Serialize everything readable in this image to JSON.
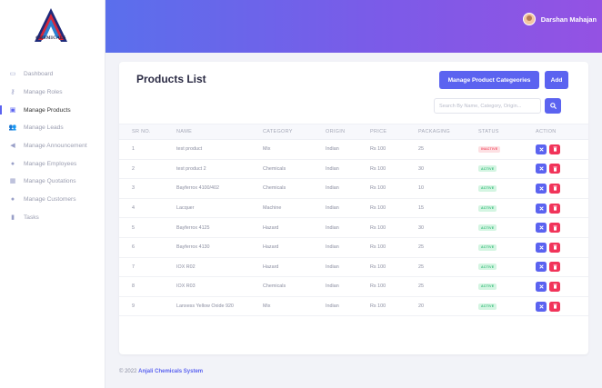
{
  "brand": {
    "logo_text": "CHEMICALS"
  },
  "header": {
    "user_name": "Darshan Mahajan"
  },
  "sidebar": {
    "items": [
      {
        "label": "Dashboard",
        "icon": "monitor-icon",
        "active": false
      },
      {
        "label": "Manage Roles",
        "icon": "key-icon",
        "active": false
      },
      {
        "label": "Manage Products",
        "icon": "box-icon",
        "active": true
      },
      {
        "label": "Manage Leads",
        "icon": "users-icon",
        "active": false
      },
      {
        "label": "Manage Announcement",
        "icon": "megaphone-icon",
        "active": false
      },
      {
        "label": "Manage Employees",
        "icon": "user-icon",
        "active": false
      },
      {
        "label": "Manage Quotations",
        "icon": "calendar-icon",
        "active": false
      },
      {
        "label": "Manage Customers",
        "icon": "user-icon",
        "active": false
      },
      {
        "label": "Tasks",
        "icon": "clipboard-icon",
        "active": false
      }
    ]
  },
  "main": {
    "title": "Products List",
    "manage_categories_label": "Manage Product Categeories",
    "add_label": "Add",
    "search_placeholder": "Search By Name, Category, Origin...",
    "columns": [
      "SR NO.",
      "NAME",
      "CATEGORY",
      "ORIGIN",
      "PRICE",
      "PACKAGING",
      "STATUS",
      "ACTION"
    ],
    "rows": [
      {
        "sr": "1",
        "name": "test product",
        "category": "Mix",
        "origin": "Indian",
        "price": "Rs 100",
        "packaging": "25",
        "status": "INACTIVE"
      },
      {
        "sr": "2",
        "name": "test product 2",
        "category": "Chemicals",
        "origin": "Indian",
        "price": "Rs 100",
        "packaging": "30",
        "status": "ACTIVE"
      },
      {
        "sr": "3",
        "name": "Bayferrox 4100/402",
        "category": "Chemicals",
        "origin": "Indian",
        "price": "Rs 100",
        "packaging": "10",
        "status": "ACTIVE"
      },
      {
        "sr": "4",
        "name": "Lacquer",
        "category": "Machine",
        "origin": "Indian",
        "price": "Rs 100",
        "packaging": "15",
        "status": "ACTIVE"
      },
      {
        "sr": "5",
        "name": "Bayferrox 4125",
        "category": "Hazard",
        "origin": "Indian",
        "price": "Rs 100",
        "packaging": "30",
        "status": "ACTIVE"
      },
      {
        "sr": "6",
        "name": "Bayferrox 4130",
        "category": "Hazard",
        "origin": "Indian",
        "price": "Rs 100",
        "packaging": "25",
        "status": "ACTIVE"
      },
      {
        "sr": "7",
        "name": "IOX R02",
        "category": "Hazard",
        "origin": "Indian",
        "price": "Rs 100",
        "packaging": "25",
        "status": "ACTIVE"
      },
      {
        "sr": "8",
        "name": "IOX R03",
        "category": "Chemicals",
        "origin": "Indian",
        "price": "Rs 100",
        "packaging": "25",
        "status": "ACTIVE"
      },
      {
        "sr": "9",
        "name": "Lanxess Yellow Oxide 920",
        "category": "Mix",
        "origin": "Indian",
        "price": "Rs 100",
        "packaging": "20",
        "status": "ACTIVE"
      }
    ]
  },
  "footer": {
    "prefix": "© 2022",
    "company": "Anjali Chemicals System"
  },
  "colors": {
    "accent": "#5b63f0",
    "delete": "#f1345a",
    "active_bg": "#d4f5e2",
    "inactive_bg": "#fde0e3"
  }
}
